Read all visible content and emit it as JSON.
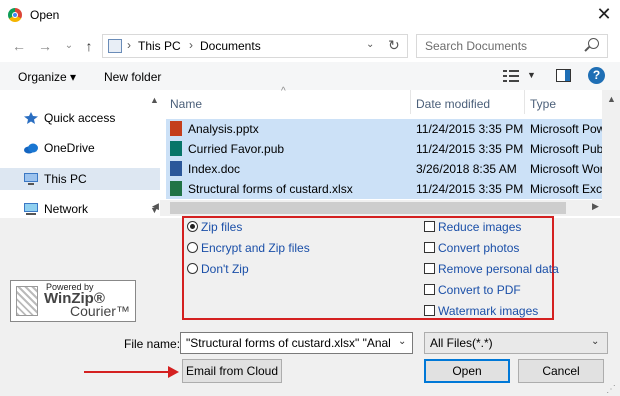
{
  "window": {
    "title": "Open",
    "close_glyph": "✕"
  },
  "nav": {
    "back": "←",
    "forward": "→",
    "recent": "⌄",
    "up": "↑",
    "breadcrumb": [
      "This PC",
      "Documents"
    ],
    "separator": "›",
    "search_placeholder": "Search Documents"
  },
  "toolbar": {
    "organize": "Organize ▾",
    "new_folder": "New folder",
    "help": "?"
  },
  "sidebar": {
    "items": [
      {
        "label": "Quick access",
        "icon": "star-icon"
      },
      {
        "label": "OneDrive",
        "icon": "cloud-icon"
      },
      {
        "label": "This PC",
        "icon": "computer-icon",
        "selected": true
      },
      {
        "label": "Network",
        "icon": "network-icon"
      }
    ]
  },
  "columns": {
    "name": "Name",
    "date": "Date modified",
    "type": "Type"
  },
  "files": [
    {
      "name": "Analysis.pptx",
      "date": "11/24/2015 3:35 PM",
      "type": "Microsoft Pow",
      "icon": "powerpoint-icon",
      "color": "#c43e1c"
    },
    {
      "name": "Curried Favor.pub",
      "date": "11/24/2015 3:35 PM",
      "type": "Microsoft Publ",
      "icon": "publisher-icon",
      "color": "#077568"
    },
    {
      "name": "Index.doc",
      "date": "3/26/2018 8:35 AM",
      "type": "Microsoft Wor",
      "icon": "word-icon",
      "color": "#2b579a"
    },
    {
      "name": "Structural forms of custard.xlsx",
      "date": "11/24/2015 3:35 PM",
      "type": "Microsoft Exce",
      "icon": "excel-icon",
      "color": "#217346"
    }
  ],
  "winzip": {
    "radios": [
      {
        "label": "Zip files",
        "checked": true
      },
      {
        "label": "Encrypt and Zip files",
        "checked": false
      },
      {
        "label": "Don't Zip",
        "checked": false
      }
    ],
    "checkboxes": [
      {
        "label": "Reduce images"
      },
      {
        "label": "Convert photos"
      },
      {
        "label": "Remove personal data"
      },
      {
        "label": "Convert to PDF"
      },
      {
        "label": "Watermark images"
      }
    ],
    "logo": {
      "powered": "Powered by",
      "name": "WinZip®",
      "product": "Courier™"
    }
  },
  "bottom": {
    "filename_label": "File name:",
    "filename_value": "\"Structural forms of custard.xlsx\" \"Analysis",
    "filetype_value": "All Files(*.*)",
    "email_button": "Email from Cloud",
    "open_button": "Open",
    "cancel_button": "Cancel"
  },
  "colors": {
    "accent": "#0078d7",
    "highlight_red": "#d42020",
    "selection": "#cce1f7"
  }
}
